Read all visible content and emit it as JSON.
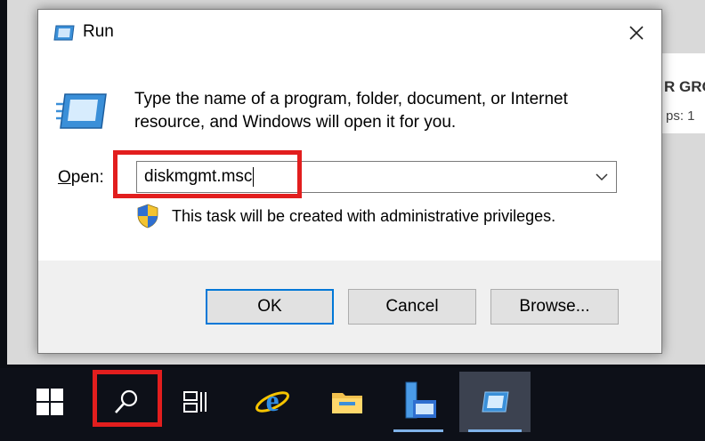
{
  "background_window": {
    "partial_heading": "R GRO",
    "partial_detail": "ps: 1"
  },
  "dialog": {
    "title": "Run",
    "close_glyph": "✕",
    "message": "Type the name of a program, folder, document, or Internet resource, and Windows will open it for you.",
    "open_label_accel": "O",
    "open_label_rest": "pen:",
    "open_value": "diskmgmt.msc",
    "admin_note": "This task will be created with administrative privileges.",
    "buttons": {
      "ok": "OK",
      "cancel": "Cancel",
      "browse": "Browse..."
    }
  },
  "taskbar": {
    "items": [
      "windows-start",
      "search",
      "task-view",
      "internet-explorer",
      "file-explorer",
      "server-manager",
      "run"
    ],
    "active_item": "run"
  },
  "colors": {
    "highlight": "#e21e1e",
    "ok_border": "#0078d7",
    "taskbar": "#0d1018"
  }
}
